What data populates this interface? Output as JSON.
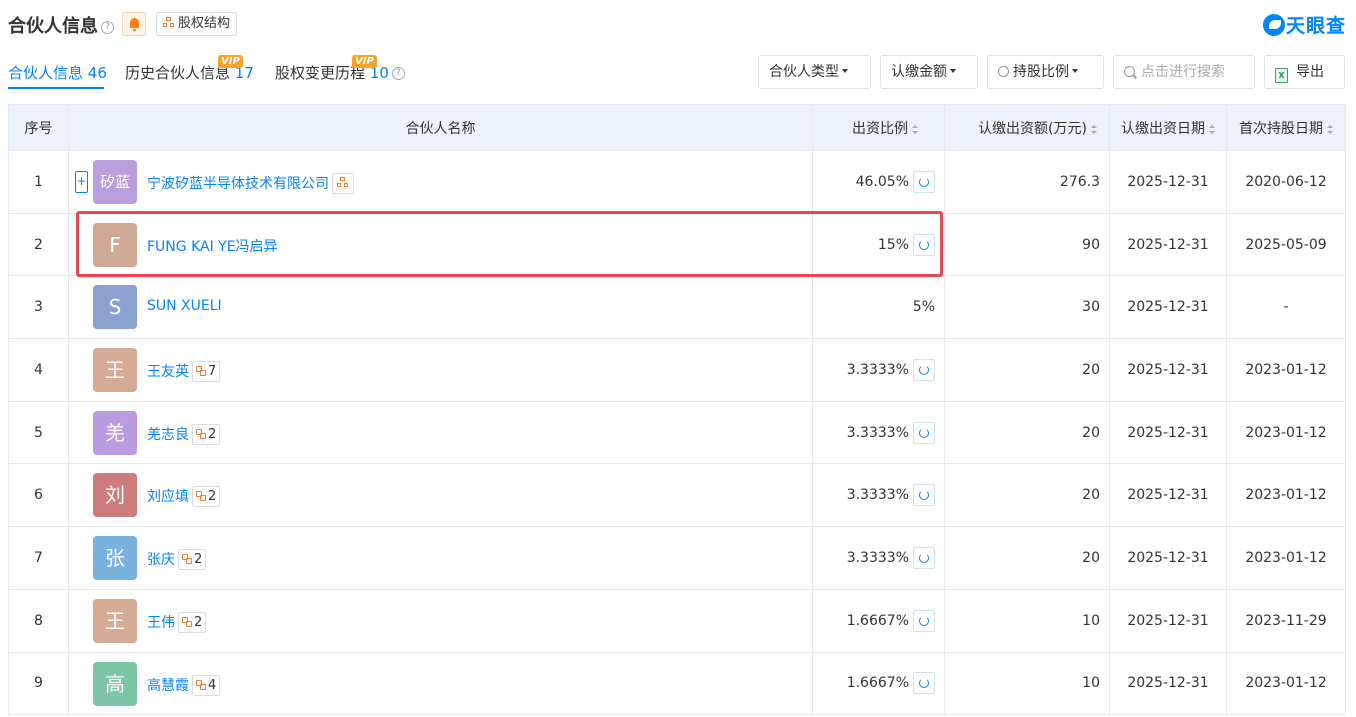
{
  "header": {
    "title": "合伙人信息",
    "help_glyph": "?",
    "bell_icon": "bell-icon",
    "structure_label": "股权结构",
    "logo_text": "天眼查"
  },
  "tabs": [
    {
      "label": "合伙人信息",
      "count": "46",
      "active": true,
      "vip": ""
    },
    {
      "label": "历史合伙人信息",
      "count": "17",
      "active": false,
      "vip": "VIP"
    },
    {
      "label": "股权变更历程",
      "count": "10",
      "active": false,
      "vip": "VIP"
    }
  ],
  "controls": {
    "partner_type": "合伙人类型",
    "subscribed_amount": "认缴金额",
    "holding_ratio": "持股比例",
    "search_placeholder": "点击进行搜索",
    "export": "导出",
    "excel_glyph": "X"
  },
  "table": {
    "columns": [
      "序号",
      "合伙人名称",
      "出资比例",
      "认缴出资额(万元)",
      "认缴出资日期",
      "首次持股日期"
    ],
    "rows": [
      {
        "idx": "1",
        "avatar": "矽蓝",
        "avatar_color": "#b9a0dc",
        "name": "宁波矽蓝半导体技术有限公司",
        "tag": "struct",
        "tag_count": "",
        "expandable": true,
        "ratio": "46.05%",
        "pie": true,
        "amount": "276.3",
        "sub_date": "2025-12-31",
        "first_date": "2020-06-12"
      },
      {
        "idx": "2",
        "avatar": "F",
        "avatar_color": "#d0a896",
        "name": "FUNG KAI YE冯启异",
        "tag": "",
        "tag_count": "",
        "expandable": false,
        "ratio": "15%",
        "pie": true,
        "amount": "90",
        "sub_date": "2025-12-31",
        "first_date": "2025-05-09"
      },
      {
        "idx": "3",
        "avatar": "S",
        "avatar_color": "#8aa1cf",
        "name": "SUN XUELI",
        "tag": "",
        "tag_count": "",
        "expandable": false,
        "ratio": "5%",
        "pie": false,
        "amount": "30",
        "sub_date": "2025-12-31",
        "first_date": "-"
      },
      {
        "idx": "4",
        "avatar": "王",
        "avatar_color": "#d5ab96",
        "name": "王友英",
        "tag": "link",
        "tag_count": "7",
        "expandable": false,
        "ratio": "3.3333%",
        "pie": true,
        "amount": "20",
        "sub_date": "2025-12-31",
        "first_date": "2023-01-12"
      },
      {
        "idx": "5",
        "avatar": "羌",
        "avatar_color": "#b99ce0",
        "name": "羌志良",
        "tag": "link",
        "tag_count": "2",
        "expandable": false,
        "ratio": "3.3333%",
        "pie": true,
        "amount": "20",
        "sub_date": "2025-12-31",
        "first_date": "2023-01-12"
      },
      {
        "idx": "6",
        "avatar": "刘",
        "avatar_color": "#cc7c7c",
        "name": "刘应填",
        "tag": "link",
        "tag_count": "2",
        "expandable": false,
        "ratio": "3.3333%",
        "pie": true,
        "amount": "20",
        "sub_date": "2025-12-31",
        "first_date": "2023-01-12"
      },
      {
        "idx": "7",
        "avatar": "张",
        "avatar_color": "#79b2dc",
        "name": "张庆",
        "tag": "link",
        "tag_count": "2",
        "expandable": false,
        "ratio": "3.3333%",
        "pie": true,
        "amount": "20",
        "sub_date": "2025-12-31",
        "first_date": "2023-01-12"
      },
      {
        "idx": "8",
        "avatar": "王",
        "avatar_color": "#d5ab96",
        "name": "王伟",
        "tag": "link",
        "tag_count": "2",
        "expandable": false,
        "ratio": "1.6667%",
        "pie": true,
        "amount": "10",
        "sub_date": "2025-12-31",
        "first_date": "2023-11-29"
      },
      {
        "idx": "9",
        "avatar": "高",
        "avatar_color": "#7dc6a3",
        "name": "高慧霞",
        "tag": "link",
        "tag_count": "4",
        "expandable": false,
        "ratio": "1.6667%",
        "pie": true,
        "amount": "10",
        "sub_date": "2025-12-31",
        "first_date": "2023-01-12"
      }
    ]
  },
  "colors": {
    "brand": "#0084ff",
    "highlight": "#e8474f",
    "header_bg": "#eaf2fc"
  }
}
